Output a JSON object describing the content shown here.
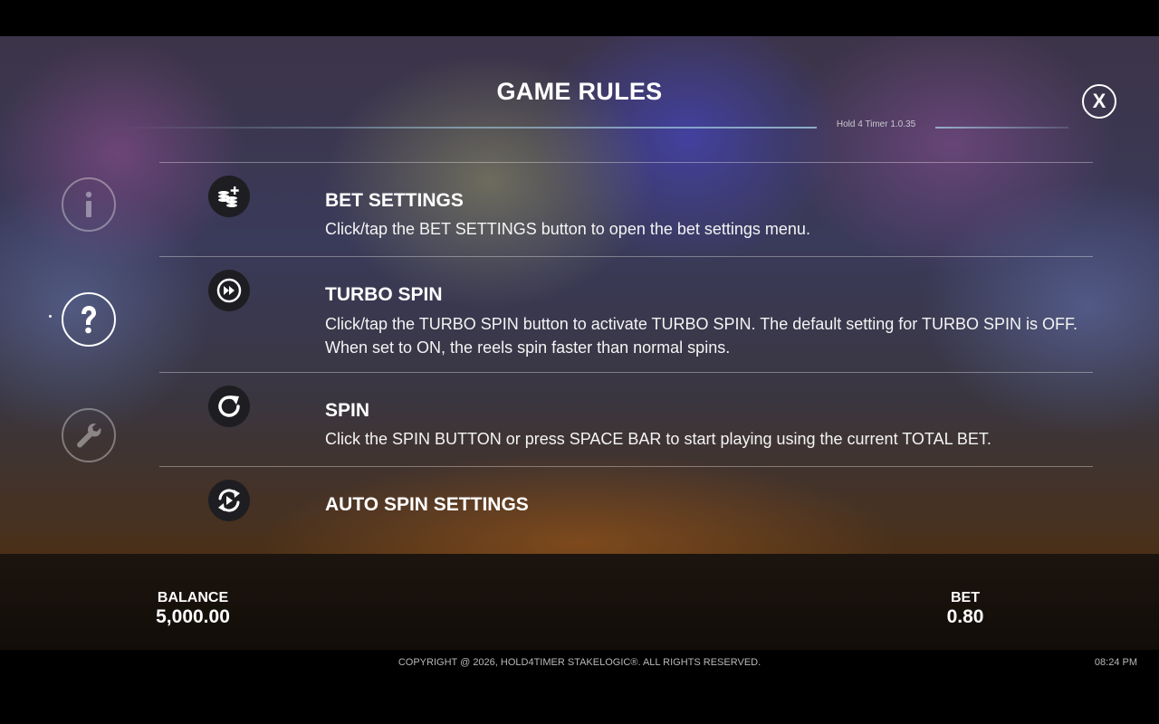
{
  "header": {
    "title": "GAME RULES",
    "version": "Hold 4 Timer 1.0.35",
    "close_label": "X"
  },
  "sidebar": {
    "items": [
      {
        "name": "info",
        "icon": "info-icon",
        "active": false
      },
      {
        "name": "help",
        "icon": "question-icon",
        "active": true
      },
      {
        "name": "settings",
        "icon": "wrench-icon",
        "active": false
      }
    ]
  },
  "rules": [
    {
      "icon": "bet-settings-icon",
      "heading": "BET SETTINGS",
      "text": "Click/tap the BET SETTINGS button to open the bet settings menu."
    },
    {
      "icon": "turbo-spin-icon",
      "heading": "TURBO SPIN",
      "text": "Click/tap the TURBO SPIN button to activate TURBO SPIN. The default setting for TURBO SPIN is OFF. When set to ON, the reels spin faster than normal spins."
    },
    {
      "icon": "spin-icon",
      "heading": "SPIN",
      "text": "Click the SPIN BUTTON or press SPACE BAR to start playing using the current TOTAL BET."
    },
    {
      "icon": "auto-spin-icon",
      "heading": "AUTO SPIN SETTINGS",
      "text": ""
    }
  ],
  "status": {
    "balance_label": "BALANCE",
    "balance_value": "5,000.00",
    "bet_label": "BET",
    "bet_value": "0.80"
  },
  "footer": {
    "copyright": "COPYRIGHT @ 2026, HOLD4TIMER STAKELOGIC®. ALL RIGHTS RESERVED.",
    "time": "08:24 PM"
  },
  "colors": {
    "text": "#ffffff",
    "icon_bg": "#1e1e22",
    "bottom_bar": "#1c140e"
  }
}
